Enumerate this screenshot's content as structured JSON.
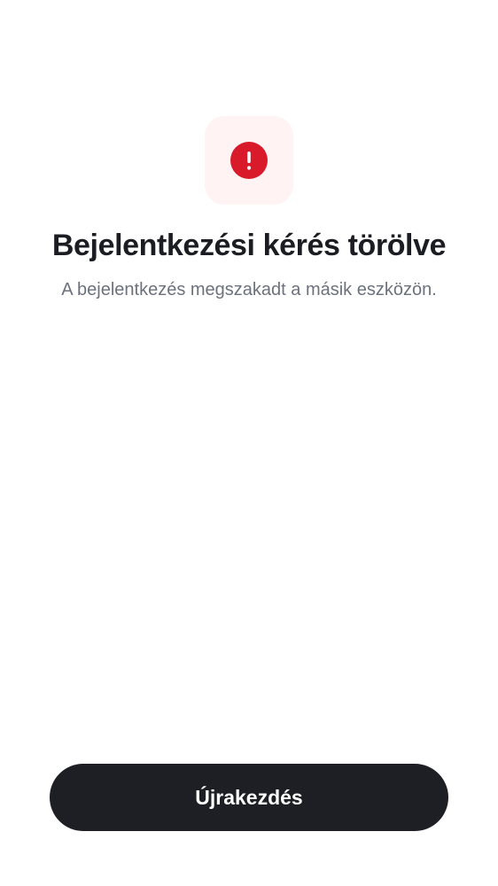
{
  "status": {
    "icon": "alert-icon",
    "icon_color": "#d91a2a",
    "tile_color": "#fff4f3",
    "title": "Bejelentkezési kérés törölve",
    "message": "A bejelentkezés megszakadt a másik eszközön."
  },
  "actions": {
    "restart_label": "Újrakezdés",
    "button_color": "#1d1f24"
  }
}
